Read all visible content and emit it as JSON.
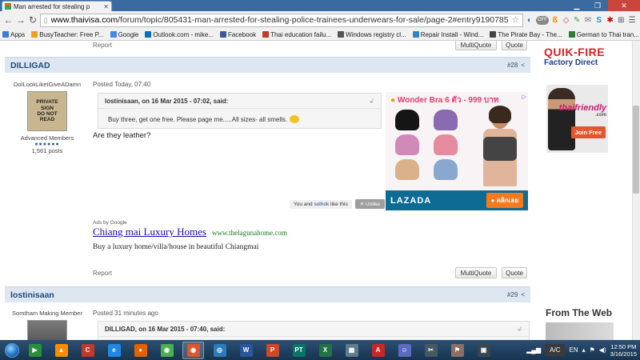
{
  "browser": {
    "tab_title": "Man arrested for stealing p",
    "tab_close": "✕",
    "url_host": "www.thaivisa.com",
    "url_path": "/forum/topic/805431-man-arrested-for-stealing-police-trainees-underwears-for-sale/page-2#entry9190785",
    "off_label": "OFF",
    "bookmarks": [
      {
        "label": "Apps",
        "icon_color": "#3a7bd5"
      },
      {
        "label": "BusyTeacher: Free P...",
        "icon_color": "#f0a020"
      },
      {
        "label": "Google",
        "icon_color": "#4285f4"
      },
      {
        "label": "Outlook.com - mike...",
        "icon_color": "#0072c6"
      },
      {
        "label": "Facebook",
        "icon_color": "#3b5998"
      },
      {
        "label": "Thai education failu...",
        "icon_color": "#c0392b"
      },
      {
        "label": "Windows registry cl...",
        "icon_color": "#555555"
      },
      {
        "label": "Repair Install - Wind...",
        "icon_color": "#2e86c1"
      },
      {
        "label": "The Pirate Bay - The...",
        "icon_color": "#444444"
      },
      {
        "label": "German to Thai tran...",
        "icon_color": "#2e7d32"
      }
    ]
  },
  "page": {
    "top_report": "Report",
    "top_multiquote": "MultiQuote",
    "top_quote": "Quote",
    "post28": {
      "username": "DILLIGAD",
      "post_number": "#28",
      "author_display": "DoILookLikeIGiveADamn",
      "avatar_sign": [
        "PRIVATE",
        "SIGN",
        "DO NOT",
        "READ"
      ],
      "rank": "Advanced Members",
      "rank_dots": "●●●●●●",
      "post_count": "1,561 posts",
      "posted": "Posted Today, 07:40",
      "quote_head": "lostinisaan, on 16 Mar 2015 - 07:02, said:",
      "quote_body": "Buy three, get one free. Please page me.....All sizes- all smells.",
      "text": "Are they leather?",
      "like_text_pre": "You and ",
      "like_user": "solhok",
      "like_text_post": " like this",
      "unlike": "Unlike",
      "report": "Report",
      "multiquote": "MultiQuote",
      "quote_btn": "Quote"
    },
    "ad": {
      "title": "Wonder Bra 6 ตัว - 999 บาท",
      "choices_icon": "▷",
      "brand": "LAZADA",
      "cta": "คลิกเลย",
      "bra_colors": [
        "#151515",
        "#8a6ab0",
        "#d089b8",
        "#e68aa0",
        "#d9b28b",
        "#8aa8cf"
      ]
    },
    "google_ads": {
      "label": "Ads by Google",
      "title": "Chiang mai Luxury Homes",
      "url": "www.thelagunahome.com",
      "desc": "Buy a luxury home/villa/house in beautiful Chiangmai"
    },
    "post29": {
      "username": "lostinisaan",
      "post_number": "#29",
      "author_display": "Somtham Making Member",
      "posted": "Posted 31 minutes ago",
      "quote_head": "DILLIGAD, on 16 Mar 2015 - 07:40, said:"
    },
    "sidebar": {
      "qf_line1": "QUIK-FIRE",
      "qf_line2": "Factory Direct",
      "dating_brand": "thai",
      "dating_brand2": "friendly",
      "dating_domain": ".com",
      "join": "Join Free",
      "from_web": "From The Web"
    }
  },
  "taskbar": {
    "apps": [
      {
        "name": "media-center",
        "color": "#2a8f3a",
        "glyph": "▶"
      },
      {
        "name": "vlc",
        "color": "#ff8c00",
        "glyph": "▲"
      },
      {
        "name": "ccleaner",
        "color": "#c0392b",
        "glyph": "C"
      },
      {
        "name": "internet-explorer",
        "color": "#1e88e5",
        "glyph": "e"
      },
      {
        "name": "firefox",
        "color": "#e66000",
        "glyph": "●"
      },
      {
        "name": "chrome",
        "color": "#4caf50",
        "glyph": "◉"
      },
      {
        "name": "chrome-active",
        "color": "#e0552b",
        "glyph": "◉"
      },
      {
        "name": "network",
        "color": "#2b7bb9",
        "glyph": "◎"
      },
      {
        "name": "word",
        "color": "#2b579a",
        "glyph": "W"
      },
      {
        "name": "powerpoint",
        "color": "#d24726",
        "glyph": "P"
      },
      {
        "name": "publisher",
        "color": "#077568",
        "glyph": "PT"
      },
      {
        "name": "excel",
        "color": "#217346",
        "glyph": "X"
      },
      {
        "name": "calculator",
        "color": "#607d8b",
        "glyph": "▦"
      },
      {
        "name": "acrobat",
        "color": "#c62828",
        "glyph": "A"
      },
      {
        "name": "people",
        "color": "#5c6bc0",
        "glyph": "☺"
      },
      {
        "name": "snipping",
        "color": "#455a64",
        "glyph": "✂"
      },
      {
        "name": "flag-app",
        "color": "#8d6e63",
        "glyph": "⚑"
      },
      {
        "name": "remote",
        "color": "#37474f",
        "glyph": "▣"
      }
    ],
    "ac_label": "A/C",
    "lang": "EN",
    "time": "12:50 PM",
    "date": "3/16/2015"
  }
}
